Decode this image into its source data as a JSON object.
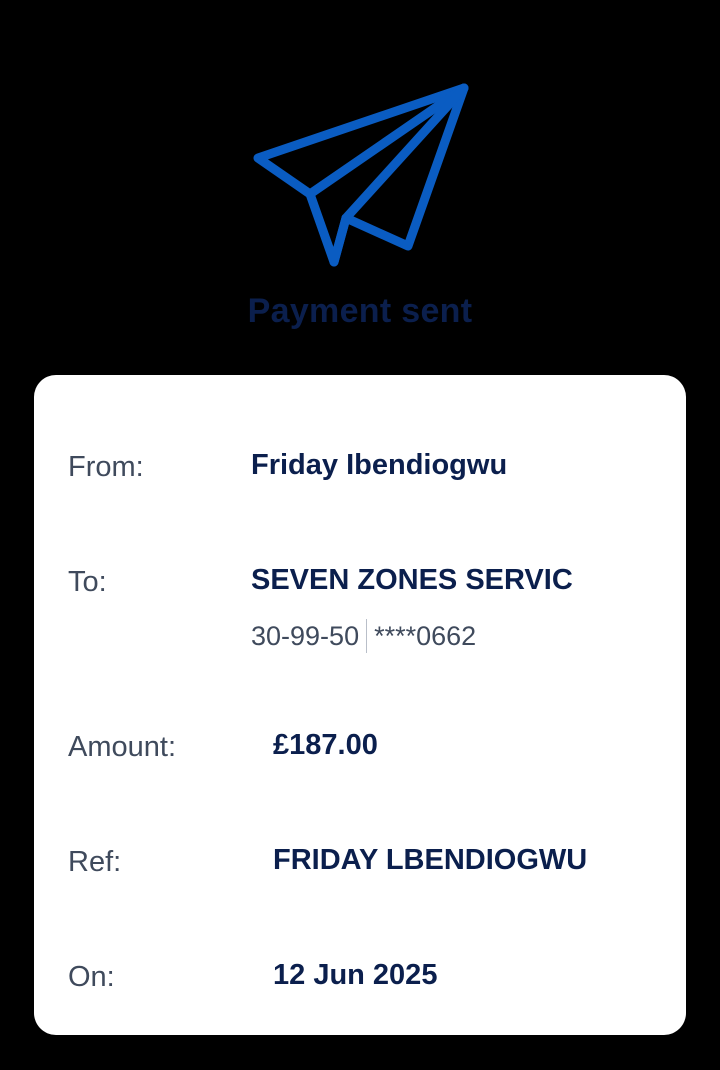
{
  "header": {
    "icon": "paper-plane-icon",
    "title": "Payment sent",
    "accent_color": "#0a5cc2"
  },
  "details": {
    "from_label": "From:",
    "from_value": "Friday Ibendiogwu",
    "to_label": "To:",
    "to_value": "SEVEN ZONES SERVIC",
    "sort_code": "30-99-50",
    "account_number": "****0662",
    "amount_label": "Amount:",
    "amount_value": "£187.00",
    "ref_label": "Ref:",
    "ref_value": "FRIDAY LBENDIOGWU",
    "on_label": "On:",
    "on_value": "12 Jun 2025"
  }
}
